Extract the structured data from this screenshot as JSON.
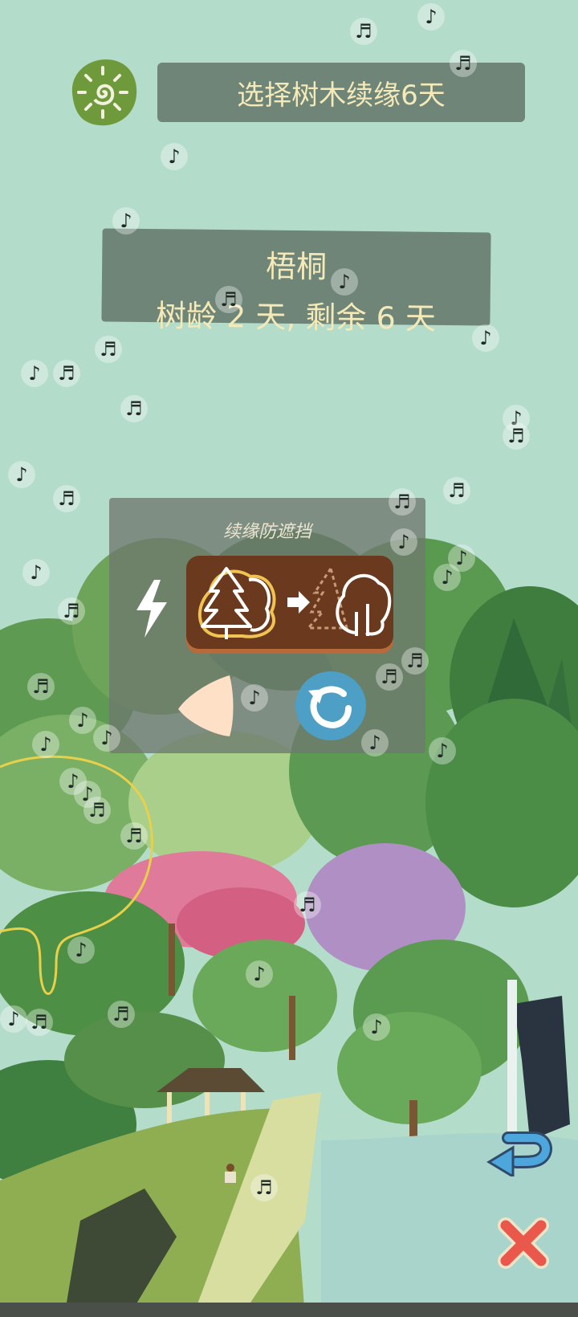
{
  "header": {
    "title": "选择树木续缘6天",
    "logo_icon": "sun-spiral-icon"
  },
  "tree_info": {
    "name": "梧桐",
    "age_text": "树龄 2 天, 剩余 6 天"
  },
  "panel": {
    "title": "续缘防遮挡",
    "lightning_icon": "lightning-icon",
    "transform_icon": "tree-to-tree-icon",
    "prev_icon": "triangle-left-icon",
    "refresh_icon": "refresh-icon"
  },
  "controls": {
    "undo_icon": "undo-arrow-icon",
    "close_icon": "close-icon"
  },
  "music_note_glyphs": {
    "single": "♪",
    "double": "♬"
  },
  "colors": {
    "sky": "#b4dccb",
    "banner": "#6e8577",
    "banner_text": "#f4e9b8",
    "logo_green": "#6e9a3c",
    "transform_bg": "#6b3a1e",
    "refresh_blue": "#4d9fc5",
    "close_red": "#e9584a",
    "undo_blue": "#4da7dc"
  }
}
